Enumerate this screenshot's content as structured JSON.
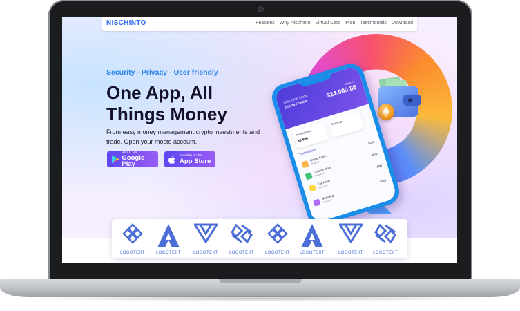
{
  "nav": {
    "brand": "NISCHINTO",
    "links": [
      "Features",
      "Why Nischinto",
      "Virtual Card",
      "Plan",
      "Testimonials",
      "Download"
    ]
  },
  "hero": {
    "tagline": "Security - Privacy - User friendly",
    "headline": "One App, All Things Money",
    "description": "From easy money management,crypto investments and trade. Open your mosto account."
  },
  "stores": {
    "google": {
      "small": "GET IT ON",
      "big": "Google Play",
      "icon": "google-play-icon"
    },
    "apple": {
      "small": "Available on the",
      "big": "App Store",
      "icon": "apple-icon"
    }
  },
  "phone": {
    "welcome": "Welcome back,",
    "user": "JACOB FISHER",
    "balance_label": "Balance",
    "balance": "$24,000.85",
    "card1_label": "Transactions",
    "card1_value": "$9,650",
    "card2_label": "Earnings",
    "card2_value": "",
    "section": "Transactions",
    "rows": [
      {
        "name": "Crypto Smith",
        "sub": "Deposit",
        "amount": "-$250",
        "color": "#ffb648"
      },
      {
        "name": "Grocery Store",
        "sub": "Payment",
        "amount": "-$740",
        "color": "#3fc47a"
      },
      {
        "name": "Car Wash",
        "sub": "Payment",
        "amount": "-$90",
        "color": "#ffd84a"
      },
      {
        "name": "Shopping",
        "sub": "Payment",
        "amount": "-$120",
        "color": "#b06cf2"
      }
    ]
  },
  "logos": [
    {
      "caption": "LOGOTEXT",
      "icon": "knot-logo-icon"
    },
    {
      "caption": "LOGOTEXT",
      "icon": "triangle-a-logo-icon"
    },
    {
      "caption": "LOGOTEXT",
      "icon": "w-logo-icon"
    },
    {
      "caption": "LOGOTEXT",
      "icon": "diamond-logo-icon"
    },
    {
      "caption": "LOGOTEXT",
      "icon": "knot-logo-icon"
    },
    {
      "caption": "LOGOTEXT",
      "icon": "triangle-a-logo-icon"
    },
    {
      "caption": "LOGOTEXT",
      "icon": "w-logo-icon"
    },
    {
      "caption": "LOGOTEXT",
      "icon": "diamond-logo-icon"
    }
  ],
  "colors": {
    "brand": "#2d6ef0",
    "tagline": "#2d86e6",
    "button_gradient_start": "#5c47f2",
    "button_gradient_end": "#9a5cf4",
    "logo": "#4b6fd6"
  }
}
